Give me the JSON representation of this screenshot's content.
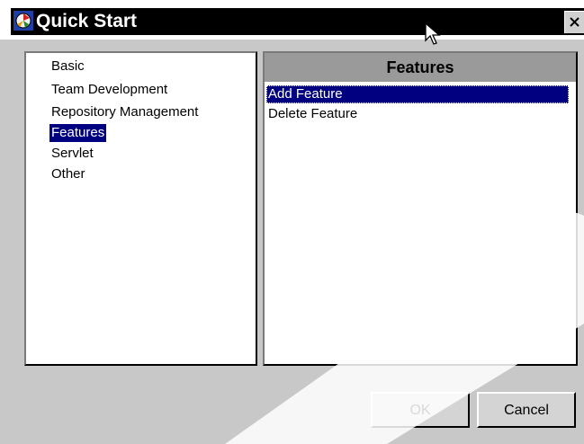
{
  "window": {
    "title": "Quick Start",
    "close_label": "Close"
  },
  "sidebar": {
    "items": [
      {
        "label": "Basic",
        "selected": false
      },
      {
        "label": "Team Development",
        "selected": false
      },
      {
        "label": "Repository Management",
        "selected": false
      },
      {
        "label": "Features",
        "selected": true
      },
      {
        "label": "Servlet",
        "selected": false
      },
      {
        "label": "Other",
        "selected": false
      }
    ]
  },
  "panel": {
    "header": "Features",
    "items": [
      {
        "label": "Add Feature",
        "selected": true
      },
      {
        "label": "Delete Feature",
        "selected": false
      }
    ]
  },
  "buttons": {
    "ok_label": "OK",
    "cancel_label": "Cancel"
  },
  "icons": {
    "app": "app-logo-icon",
    "close": "close-icon",
    "cursor": "mouse-pointer-icon"
  },
  "colors": {
    "title_bar": "#000000",
    "selection": "#000080",
    "panel_header": "#9a9a9a",
    "dialog_face": "#c8c8c8"
  }
}
